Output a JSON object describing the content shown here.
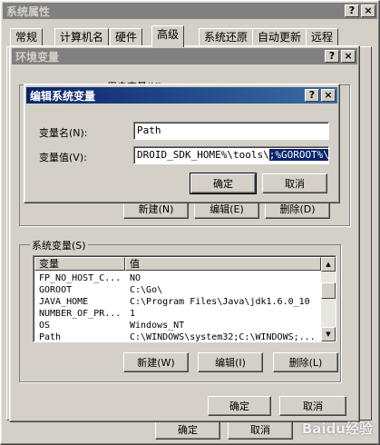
{
  "sys_props": {
    "title": "系统属性",
    "help_btn": "?",
    "close_btn": "×",
    "tabs": [
      {
        "label": "常规"
      },
      {
        "label": "计算机名"
      },
      {
        "label": "硬件"
      },
      {
        "label": "高级"
      },
      {
        "label": "系统还原"
      },
      {
        "label": "自动更新"
      },
      {
        "label": "远程"
      }
    ],
    "ok": "确定",
    "cancel": "取消"
  },
  "env_vars": {
    "title": "环境变量",
    "help_btn": "?",
    "close_btn": "×",
    "user_group_label": "用户变量(U)",
    "user_buttons": {
      "new": "新建(N)",
      "edit": "编辑(E)",
      "delete": "删除(D)"
    },
    "sys_group_label": "系统变量(S)",
    "columns": {
      "var": "变量",
      "val": "值"
    },
    "rows": [
      {
        "var": "FP_NO_HOST_C...",
        "val": "NO"
      },
      {
        "var": "GOROOT",
        "val": "C:\\Go\\"
      },
      {
        "var": "JAVA_HOME",
        "val": "C:\\Program Files\\Java\\jdk1.6.0_10"
      },
      {
        "var": "NUMBER_OF_PR...",
        "val": "1"
      },
      {
        "var": "OS",
        "val": "Windows_NT"
      },
      {
        "var": "Path",
        "val": "C:\\WINDOWS\\system32;C:\\WINDOWS;..."
      }
    ],
    "sys_buttons": {
      "new": "新建(W)",
      "edit": "编辑(I)",
      "delete": "删除(L)"
    },
    "ok": "确定",
    "cancel": "取消"
  },
  "edit_dialog": {
    "title": "编辑系统变量",
    "help_btn": "?",
    "close_btn": "×",
    "name_label": "变量名(N):",
    "name_value": "Path",
    "value_label": "变量值(V):",
    "value_prefix": "DROID_SDK_HOME%\\tools\\",
    "value_selected": ";%GOROOT%\\bir",
    "ok": "确定",
    "cancel": "取消"
  },
  "watermark": "Baidu经验"
}
